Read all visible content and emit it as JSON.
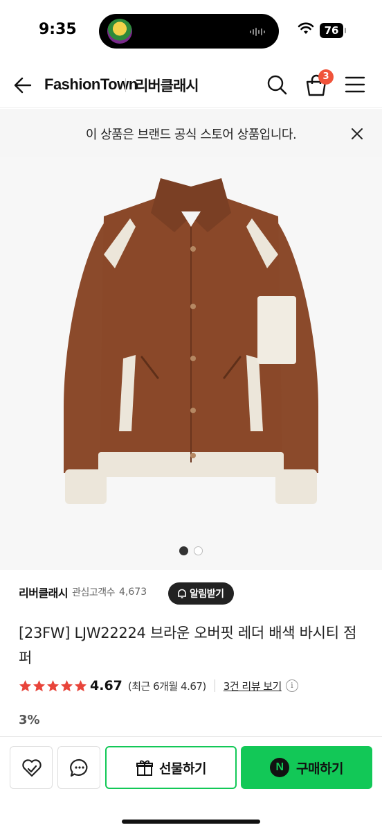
{
  "status_bar": {
    "time": "9:35",
    "battery": "76"
  },
  "header": {
    "brand": "FashionTown",
    "store_name": "리버클래시",
    "cart_count": "3"
  },
  "notice": {
    "text": "이 상품은 브랜드 공식 스토어 상품입니다."
  },
  "gallery": {
    "total": 2,
    "active": 1
  },
  "store": {
    "name": "리버클래시",
    "fav_label": "관심고객수",
    "fav_count": "4,673",
    "alert_label": "알림받기"
  },
  "product": {
    "title": "[23FW] LJW22224 브라운 오버핏 레더 배색 바시티 점퍼",
    "rating": "4.67",
    "rating_stars": 4.67,
    "recent_rating": "(최근 6개월 4.67)",
    "review_link": "3건 리뷰 보기",
    "discount": "3%"
  },
  "bottom_bar": {
    "gift_label": "선물하기",
    "buy_label": "구매하기",
    "npay_mark": "N"
  },
  "colors": {
    "accent_green": "#12c857",
    "badge_red": "#f0533a",
    "star_red": "#e8443a",
    "jacket_brown": "#8b4a2b"
  }
}
